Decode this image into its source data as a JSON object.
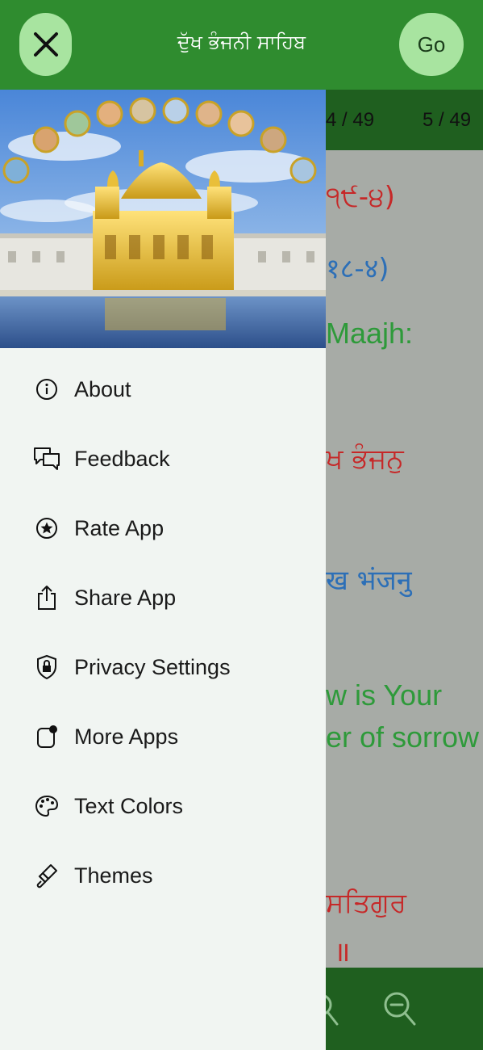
{
  "header": {
    "title": "ਦੁੱਖ ਭੰਜਨੀ ਸਾਹਿਬ",
    "go_label": "Go"
  },
  "pagebar": {
    "left": "4 / 49",
    "right": "5 / 49"
  },
  "content_lines": [
    "੧੯-੪)",
    "१८-४)",
    "Maajh:",
    "ਖ ਭੰਜਨੁ",
    "ख भंजनु",
    "w is Your",
    "er of sorrow",
    "ਸਤਿਗੁਰ",
    "॥"
  ],
  "menu": {
    "items": [
      {
        "label": "About",
        "icon": "info-icon"
      },
      {
        "label": "Feedback",
        "icon": "chat-bubbles-icon"
      },
      {
        "label": "Rate App",
        "icon": "star-circle-icon"
      },
      {
        "label": "Share App",
        "icon": "share-icon"
      },
      {
        "label": "Privacy Settings",
        "icon": "shield-lock-icon"
      },
      {
        "label": "More Apps",
        "icon": "app-badge-icon"
      },
      {
        "label": "Text Colors",
        "icon": "palette-icon"
      },
      {
        "label": "Themes",
        "icon": "paintbrush-icon"
      }
    ]
  },
  "colors": {
    "header_green": "#2f8c2f",
    "dark_green": "#1f5f1f",
    "button_green": "#a8e4a0",
    "drawer_bg": "#f1f5f2"
  }
}
